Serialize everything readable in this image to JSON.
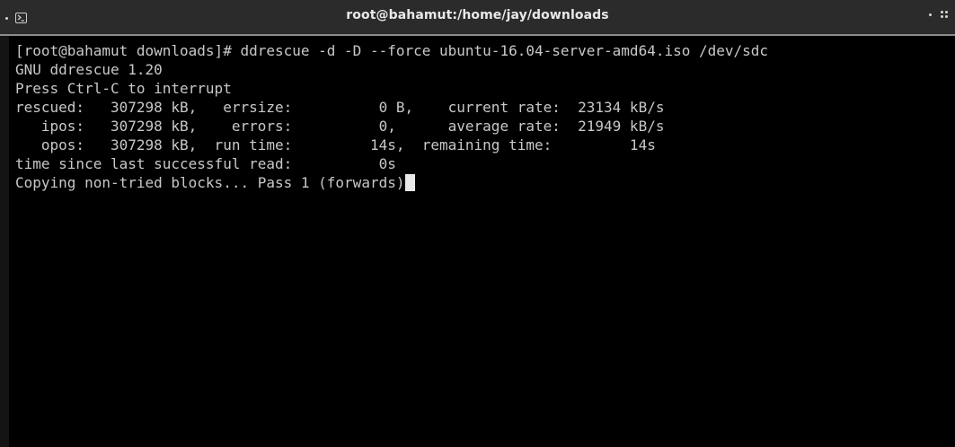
{
  "window": {
    "title": "root@bahamut:/home/jay/downloads",
    "icons": [
      "menu-dot-icon",
      "terminal-icon",
      "minimize-dot-icon",
      "grip-icon"
    ]
  },
  "terminal": {
    "lines": [
      "[root@bahamut downloads]# ddrescue -d -D --force ubuntu-16.04-server-amd64.iso /dev/sdc",
      "GNU ddrescue 1.20",
      "Press Ctrl-C to interrupt",
      "rescued:   307298 kB,   errsize:          0 B,    current rate:  23134 kB/s",
      "   ipos:   307298 kB,    errors:          0,      average rate:  21949 kB/s",
      "   opos:   307298 kB,  run time:         14s,  remaining time:         14s",
      "time since last successful read:          0s",
      "Copying non-tried blocks... Pass 1 (forwards)"
    ]
  },
  "colors": {
    "background": "#000000",
    "text": "#c8c8c8",
    "titlebar": "#2b2b2b",
    "cursor": "#e8e8e8"
  }
}
